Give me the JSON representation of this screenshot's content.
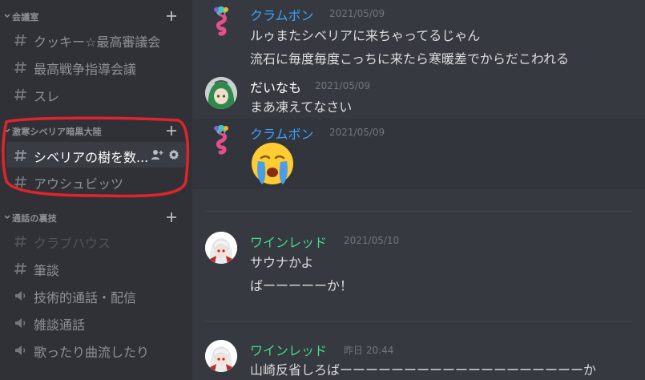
{
  "sidebar": {
    "categories": [
      {
        "label": "会議室"
      },
      {
        "label": "激寒シベリア暗黒大陸"
      },
      {
        "label": "通話の裏技"
      }
    ],
    "channels": [
      {
        "label": "クッキー☆最高審議会",
        "type": "text"
      },
      {
        "label": "最高戦争指導会議",
        "type": "text"
      },
      {
        "label": "スレ",
        "type": "text"
      },
      {
        "label": "シベリアの樹を数...",
        "type": "text",
        "active": true
      },
      {
        "label": "アウシュビッツ",
        "type": "text"
      },
      {
        "label": "クラブハウス",
        "type": "text",
        "muted": true
      },
      {
        "label": "筆談",
        "type": "text"
      },
      {
        "label": "技術的通話・配信",
        "type": "voice"
      },
      {
        "label": "雑談通話",
        "type": "voice"
      },
      {
        "label": "歌ったり曲流したり",
        "type": "voice"
      }
    ]
  },
  "messages": [
    {
      "username": "クラムボン",
      "name_color": "#3ba1ff",
      "timestamp": "2021/05/09",
      "lines": [
        "ルゥまたシベリアに来ちゃってるじゃん",
        "流石に毎度毎度こっちに来たら寒暖差でからだこわれる"
      ],
      "avatar": "seahorse-avatar"
    },
    {
      "username": "だいなも",
      "name_color": "#ffffff",
      "timestamp": "2021/05/09",
      "lines": [
        "まあ凍えてなさい"
      ],
      "avatar": "green-hair-avatar"
    },
    {
      "username": "クラムボン",
      "name_color": "#3ba1ff",
      "timestamp": "2021/05/09",
      "lines": [],
      "emoji": "crying-face-emoji",
      "avatar": "seahorse-avatar"
    },
    {
      "username": "ワインレッド",
      "name_color": "#43d98b",
      "timestamp": "2021/05/10",
      "lines": [
        "サウナかよ",
        "ばーーーーーか！"
      ],
      "avatar": "white-hair-avatar"
    },
    {
      "username": "ワインレッド",
      "name_color": "#43d98b",
      "timestamp": "昨日 20:44",
      "lines": [
        "山崎反省しろばーーーーーーーーーーーーーーーーーーーか"
      ],
      "avatar": "white-hair-avatar"
    }
  ],
  "colors": {
    "sidebar_bg": "#2f3136",
    "chat_bg": "#36393f",
    "annotation": "#e0242b"
  }
}
